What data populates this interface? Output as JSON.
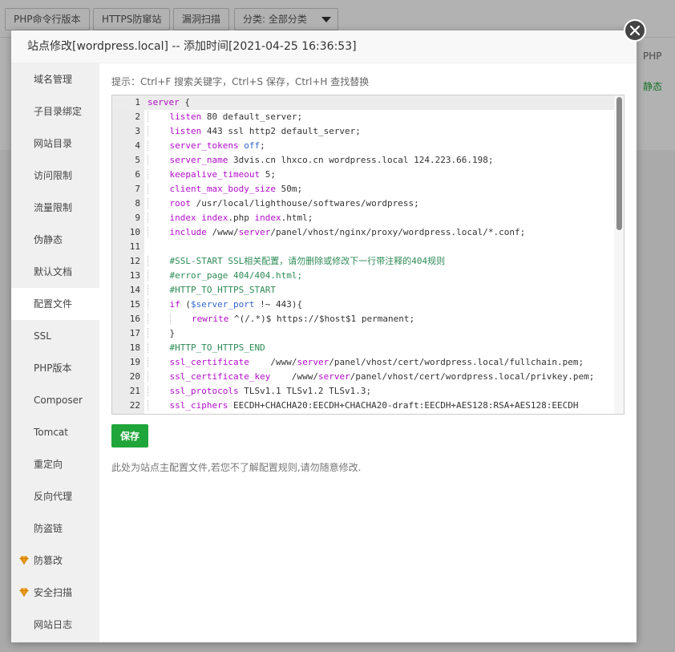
{
  "background": {
    "toolbar_buttons": [
      "PHP命令行版本",
      "HTTPS防窜站",
      "漏洞扫描"
    ],
    "category_select": "分类: 全部分类",
    "right_header": "PHP",
    "right_status": "静态"
  },
  "dialog": {
    "title": "站点修改[wordpress.local] -- 添加时间[2021-04-25 16:36:53]"
  },
  "sidebar": {
    "items": [
      {
        "label": "域名管理"
      },
      {
        "label": "子目录绑定"
      },
      {
        "label": "网站目录"
      },
      {
        "label": "访问限制"
      },
      {
        "label": "流量限制"
      },
      {
        "label": "伪静态"
      },
      {
        "label": "默认文档"
      },
      {
        "label": "配置文件"
      },
      {
        "label": "SSL"
      },
      {
        "label": "PHP版本"
      },
      {
        "label": "Composer"
      },
      {
        "label": "Tomcat"
      },
      {
        "label": "重定向"
      },
      {
        "label": "反向代理"
      },
      {
        "label": "防盗链"
      },
      {
        "label": "防篡改"
      },
      {
        "label": "安全扫描"
      },
      {
        "label": "网站日志"
      }
    ],
    "active_index": 7,
    "premium_icon": "diamond-icon"
  },
  "editor": {
    "tip": "提示：Ctrl+F 搜索关键字，Ctrl+S 保存，Ctrl+H 查找替换",
    "lines": [
      {
        "n": "1",
        "text": "server {"
      },
      {
        "n": "2",
        "text": "    listen 80 default_server;"
      },
      {
        "n": "3",
        "text": "    listen 443 ssl http2 default_server;"
      },
      {
        "n": "4",
        "text": "    server_tokens off;"
      },
      {
        "n": "5",
        "text": "    server_name 3dvis.cn lhxco.cn wordpress.local 124.223.66.198;"
      },
      {
        "n": "6",
        "text": "    keepalive_timeout 5;"
      },
      {
        "n": "7",
        "text": "    client_max_body_size 50m;"
      },
      {
        "n": "8",
        "text": "    root /usr/local/lighthouse/softwares/wordpress;"
      },
      {
        "n": "9",
        "text": "    index index.php index.html;"
      },
      {
        "n": "10",
        "text": "    include /www/server/panel/vhost/nginx/proxy/wordpress.local/*.conf;"
      },
      {
        "n": "11",
        "text": ""
      },
      {
        "n": "12",
        "text": "    #SSL-START SSL相关配置，请勿删除或修改下一行带注释的404规则"
      },
      {
        "n": "13",
        "text": "    #error_page 404/404.html;"
      },
      {
        "n": "14",
        "text": "    #HTTP_TO_HTTPS_START"
      },
      {
        "n": "15",
        "text": "    if ($server_port !~ 443){"
      },
      {
        "n": "16",
        "text": "        rewrite ^(/.*)$ https://$host$1 permanent;"
      },
      {
        "n": "17",
        "text": "    }"
      },
      {
        "n": "18",
        "text": "    #HTTP_TO_HTTPS_END"
      },
      {
        "n": "19",
        "text": "    ssl_certificate    /www/server/panel/vhost/cert/wordpress.local/fullchain.pem;"
      },
      {
        "n": "20",
        "text": "    ssl_certificate_key    /www/server/panel/vhost/cert/wordpress.local/privkey.pem;"
      },
      {
        "n": "21",
        "text": "    ssl_protocols TLSv1.1 TLSv1.2 TLSv1.3;"
      },
      {
        "n": "22",
        "text": "    ssl_ciphers EECDH+CHACHA20:EECDH+CHACHA20-draft:EECDH+AES128:RSA+AES128:EECDH"
      }
    ],
    "current_line": 0,
    "save_label": "保存",
    "note": "此处为站点主配置文件,若您不了解配置规则,请勿随意修改."
  },
  "colors": {
    "keyword": "#b10dc9",
    "comment": "#2e8b57",
    "value": "#3366cc",
    "save_button": "#20a53a",
    "status_green": "#20a53a"
  }
}
